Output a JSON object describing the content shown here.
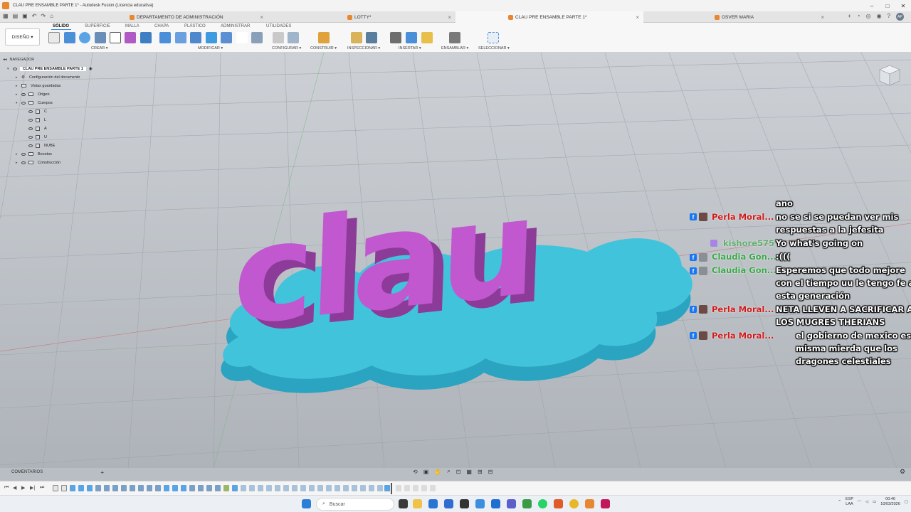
{
  "window": {
    "title": "CLAU PRE ENSAMBLE PARTE 1* - Autodesk Fusion (Licencia educativa)",
    "controls": [
      "–",
      "□",
      "✕"
    ]
  },
  "tabs": [
    {
      "label": "DEPARTAMENTO DE ADMINISTRACIÓN",
      "active": false
    },
    {
      "label": "LOTTY*",
      "active": false
    },
    {
      "label": "CLAU PRE ENSAMBLE PARTE 1*",
      "active": true
    },
    {
      "label": "OSVER MARIA",
      "active": false
    }
  ],
  "user_initials": "AP",
  "toolbar": {
    "workspace": "DISEÑO ▾",
    "ribbon_tabs": [
      "SÓLIDO",
      "SUPERFICIE",
      "MALLA",
      "CHAPA",
      "PLÁSTICO",
      "ADMINISTRAR",
      "UTILIDADES"
    ],
    "groups": [
      "CREAR ▾",
      "MODIFICAR ▾",
      "CONFIGURAR ▾",
      "CONSTRUIR ▾",
      "INSPECCIONAR ▾",
      "INSERTAR ▾",
      "ENSAMBLAR ▾",
      "SELECCIONAR ▾"
    ]
  },
  "browser": {
    "header": "NAVEGADOR",
    "root": "CLAU PRE ENSAMBLE PARTE 1",
    "items": [
      {
        "label": "Configuración del documento",
        "kind": "settings"
      },
      {
        "label": "Vistas guardadas",
        "kind": "folder"
      },
      {
        "label": "Origen",
        "kind": "folder"
      },
      {
        "label": "Cuerpos",
        "kind": "folder"
      },
      {
        "label": "C",
        "kind": "body"
      },
      {
        "label": "L",
        "kind": "body"
      },
      {
        "label": "A",
        "kind": "body"
      },
      {
        "label": "U",
        "kind": "body"
      },
      {
        "label": "NUBE",
        "kind": "body"
      },
      {
        "label": "Bocetos",
        "kind": "folder"
      },
      {
        "label": "Construcción",
        "kind": "folder"
      }
    ]
  },
  "model": {
    "text": "clau",
    "letter_color": "#c155cc",
    "base_color": "#3cb8d2"
  },
  "chat": [
    {
      "name": "",
      "text": "ano"
    },
    {
      "name": "Perla Moral...",
      "name_color": "#d11a1a",
      "text": "no se si se puedan ver mis"
    },
    {
      "name": "",
      "text": "respuestas a la jefesita"
    },
    {
      "name": "kishore575",
      "name_color": "#3aa84a",
      "text": "Yo what's going on"
    },
    {
      "name": "Claudia Gon...",
      "name_color": "#3aa84a",
      "text": ":((("
    },
    {
      "name": "Claudia Gon...",
      "name_color": "#3aa84a",
      "text": "Esperemos que todo mejore"
    },
    {
      "name": "",
      "text": "con el tiempo uu le tengo fe a"
    },
    {
      "name": "",
      "text": "esta generación"
    },
    {
      "name": "Perla Moral...",
      "name_color": "#d11a1a",
      "text": "NETA LLEVEN A SACRIFICAR A"
    },
    {
      "name": "",
      "text": "LOS MUGRES THERIANS"
    },
    {
      "name": "Perla Moral...",
      "name_color": "#d11a1a",
      "text": "el gobierno de mexico es la"
    },
    {
      "name": "",
      "text": "misma mierda que los"
    },
    {
      "name": "",
      "text": "dragones celestiales"
    }
  ],
  "comments_label": "COMENTARIOS",
  "taskbar": {
    "search_placeholder": "Buscar",
    "lang": "ESP",
    "region": "LAA",
    "time": "00:46",
    "date": "10/03/2026"
  }
}
